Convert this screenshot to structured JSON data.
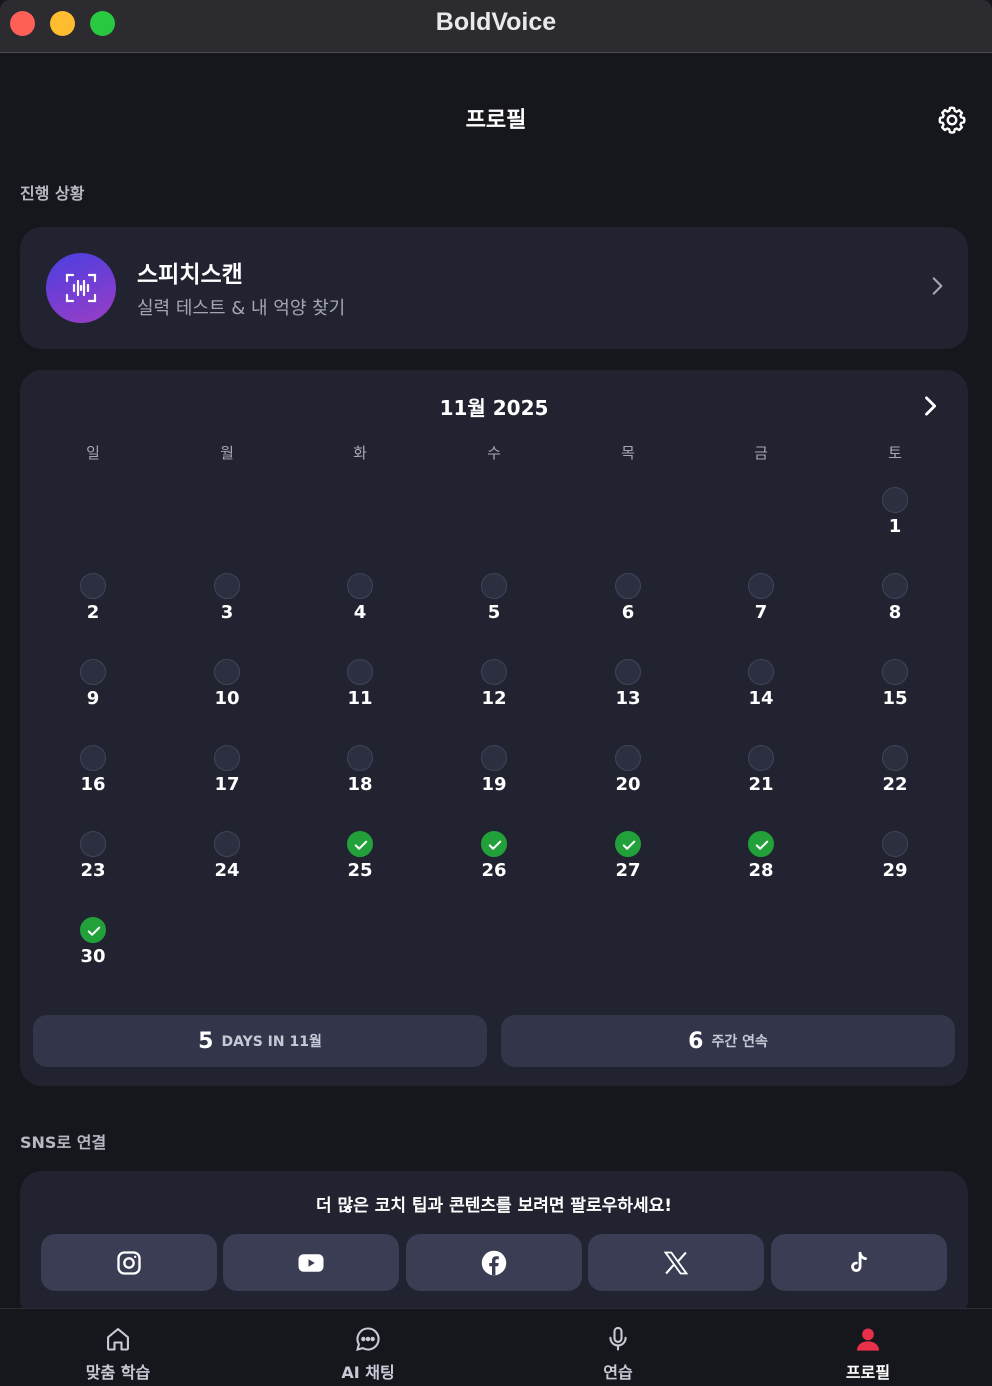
{
  "window": {
    "title": "BoldVoice"
  },
  "header": {
    "title": "프로필",
    "settings_icon": "gear-icon"
  },
  "progress": {
    "section_label": "진행 상황"
  },
  "speech_scan": {
    "title": "스피치스캔",
    "subtitle": "실력 테스트 & 내 억양 찾기",
    "icon": "voice-scan-icon"
  },
  "calendar": {
    "title": "11월 2025",
    "weekdays": [
      "일",
      "월",
      "화",
      "수",
      "목",
      "금",
      "토"
    ],
    "days": [
      {
        "day": "1",
        "done": false
      },
      {
        "day": "2",
        "done": false
      },
      {
        "day": "3",
        "done": false
      },
      {
        "day": "4",
        "done": false
      },
      {
        "day": "5",
        "done": false
      },
      {
        "day": "6",
        "done": false
      },
      {
        "day": "7",
        "done": false
      },
      {
        "day": "8",
        "done": false
      },
      {
        "day": "9",
        "done": false
      },
      {
        "day": "10",
        "done": false
      },
      {
        "day": "11",
        "done": false
      },
      {
        "day": "12",
        "done": false
      },
      {
        "day": "13",
        "done": false
      },
      {
        "day": "14",
        "done": false
      },
      {
        "day": "15",
        "done": false
      },
      {
        "day": "16",
        "done": false
      },
      {
        "day": "17",
        "done": false
      },
      {
        "day": "18",
        "done": false
      },
      {
        "day": "19",
        "done": false
      },
      {
        "day": "20",
        "done": false
      },
      {
        "day": "21",
        "done": false
      },
      {
        "day": "22",
        "done": false
      },
      {
        "day": "23",
        "done": false
      },
      {
        "day": "24",
        "done": false
      },
      {
        "day": "25",
        "done": true
      },
      {
        "day": "26",
        "done": true
      },
      {
        "day": "27",
        "done": true
      },
      {
        "day": "28",
        "done": true
      },
      {
        "day": "29",
        "done": false
      },
      {
        "day": "30",
        "done": true
      }
    ],
    "stats": [
      {
        "value": "5",
        "label": "DAYS IN 11월"
      },
      {
        "value": "6",
        "label": "주간 연속"
      }
    ]
  },
  "sns": {
    "section_label": "SNS로 연결",
    "prompt": "더 많은 코치 팁과 콘텐츠를 보려면 팔로우하세요!",
    "buttons": [
      "instagram-icon",
      "youtube-icon",
      "facebook-icon",
      "x-icon",
      "tiktok-icon"
    ]
  },
  "tabs": [
    {
      "label": "맞춤 학습",
      "icon": "home-icon",
      "active": false
    },
    {
      "label": "AI 채팅",
      "icon": "chat-bubble-icon",
      "active": false
    },
    {
      "label": "연습",
      "icon": "microphone-icon",
      "active": false
    },
    {
      "label": "프로필",
      "icon": "profile-icon",
      "active": true
    }
  ],
  "colors": {
    "accent": "#e8304a",
    "done": "#22a03a",
    "card": "#212330",
    "background": "#16161d"
  }
}
